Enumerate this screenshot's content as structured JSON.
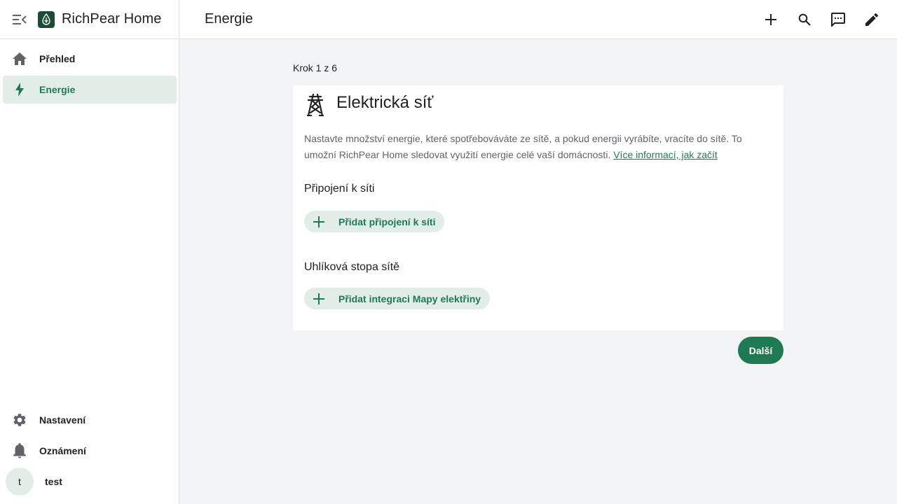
{
  "app": {
    "brand": "RichPear Home",
    "page_title": "Energie"
  },
  "sidebar": {
    "items": [
      {
        "label": "Přehled",
        "icon": "home-icon",
        "active": false
      },
      {
        "label": "Energie",
        "icon": "lightning-icon",
        "active": true
      }
    ],
    "bottom_items": [
      {
        "label": "Nastavení",
        "icon": "gear-icon"
      },
      {
        "label": "Oznámení",
        "icon": "bell-icon"
      }
    ],
    "user": {
      "initial": "t",
      "name": "test"
    }
  },
  "toolbar": {
    "icons": [
      "plus-icon",
      "search-icon",
      "chat-icon",
      "pencil-icon"
    ]
  },
  "wizard": {
    "step_label": "Krok 1 z 6",
    "card_title": "Elektrická síť",
    "card_icon": "transmission-tower-icon",
    "description": "Nastavte množství energie, které spotřebováváte ze sítě, a pokud energii vyrábíte, vracíte do sítě. To umožní RichPear Home sledovat využití energie celé vaší domácnosti. ",
    "link_text": "Více informací, jak začít",
    "grid_section_title": "Připojení k síti",
    "grid_button_label": "Přidat připojení k síti",
    "carbon_section_title": "Uhlíková stopa sítě",
    "carbon_button_label": "Přidat integraci Mapy elektřiny",
    "next_label": "Další"
  },
  "colors": {
    "accent": "#1f7a54",
    "accent_light": "#e2ede8",
    "background": "#f2f3f5"
  }
}
